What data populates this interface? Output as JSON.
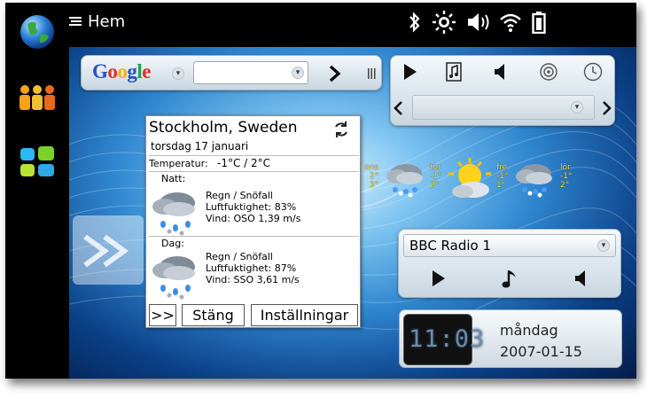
{
  "topbar": {
    "title": "Hem",
    "status_icons": [
      "bluetooth-icon",
      "brightness-icon",
      "volume-icon",
      "wifi-icon",
      "battery-icon"
    ]
  },
  "sidebar": {
    "items": [
      {
        "icon": "globe-icon"
      },
      {
        "icon": "contacts-icon"
      },
      {
        "icon": "applications-icon"
      }
    ]
  },
  "google": {
    "logo": "Google"
  },
  "media_controls": [
    "play-icon",
    "music-note-icon",
    "volume-icon",
    "radio-icon",
    "clock-icon"
  ],
  "weather": {
    "city": "Stockholm, Sweden",
    "date": "torsdag 17 januari",
    "temp_label": "Temperatur:",
    "temp_value": "-1°C / 2°C",
    "night": {
      "label": "Natt:",
      "condition": "Regn / Snöfall",
      "humidity": "Luftfuktighet: 83%",
      "wind": "Vind: OSO 1,39 m/s"
    },
    "day": {
      "label": "Dag:",
      "condition": "Regn / Snöfall",
      "humidity": "Luftfuktighet: 87%",
      "wind": "Vind: SSO 3,61 m/s"
    },
    "buttons": {
      "more": ">>",
      "close": "Stäng",
      "settings": "Inställningar"
    }
  },
  "forecast": [
    {
      "day": "ons",
      "high": "2°",
      "low": "3°"
    },
    {
      "day": "tor",
      "high": "-1°",
      "low": "2°"
    },
    {
      "day": "fre",
      "high": "-1°",
      "low": "1°"
    },
    {
      "day": "lör",
      "high": "-1°",
      "low": "2°"
    }
  ],
  "radio": {
    "station": "BBC Radio 1"
  },
  "clock": {
    "time": "11:03",
    "day": "måndag",
    "date": "2007-01-15"
  },
  "colors": {
    "forecast_text": "#ffe33a",
    "clock_digits": "#6e8aa8"
  }
}
